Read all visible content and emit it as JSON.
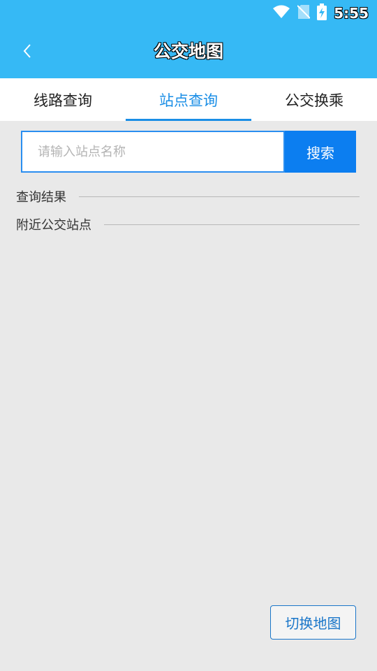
{
  "status_bar": {
    "time": "5:55",
    "icons": [
      "wifi-icon",
      "no-sim-icon",
      "battery-charging-icon"
    ]
  },
  "header": {
    "back_icon": "chevron-left-icon",
    "title": "公交地图"
  },
  "tabs": [
    {
      "label": "线路查询",
      "active": false
    },
    {
      "label": "站点查询",
      "active": true
    },
    {
      "label": "公交换乘",
      "active": false
    }
  ],
  "search": {
    "value": "",
    "placeholder": "请输入站点名称",
    "button_label": "搜索"
  },
  "sections": {
    "results_label": "查询结果",
    "nearby_label": "附近公交站点"
  },
  "map_toggle_label": "切换地图",
  "colors": {
    "header_bg": "#36b9f5",
    "accent": "#1a8ee6",
    "search_button": "#0c7ef0",
    "page_bg": "#e9e9e9"
  }
}
